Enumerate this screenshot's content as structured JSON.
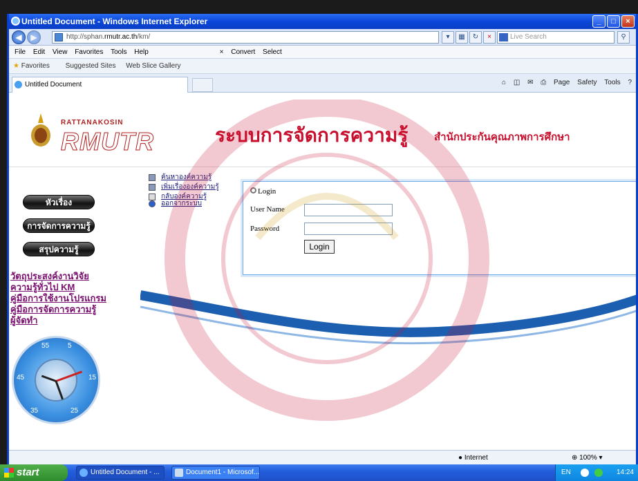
{
  "window": {
    "title": "Untitled Document - Windows Internet Explorer"
  },
  "address": {
    "url_prefix": "http://sphan.",
    "url_host": "rmutr.ac.th",
    "url_path": "/km/",
    "search_placeholder": "Live Search"
  },
  "menubar": {
    "items": [
      "File",
      "Edit",
      "View",
      "Favorites",
      "Tools",
      "Help"
    ],
    "convert": "Convert",
    "select": "Select"
  },
  "favbar": {
    "favorites": "Favorites",
    "suggested": "Suggested Sites",
    "webslice": "Web Slice Gallery"
  },
  "tab": {
    "title": "Untitled Document"
  },
  "cmdbar": {
    "page": "Page",
    "safety": "Safety",
    "tools": "Tools"
  },
  "banner": {
    "brand_top": "RATTANAKOSIN",
    "brand_main": "RMUTR",
    "title": "ระบบการจัดการความรู้",
    "subtitle": "สำนักประกันคุณภาพการศึกษา"
  },
  "left": {
    "pills": [
      "หัวเรื่อง",
      "การจัดการความรู้",
      "สรุปความรู้"
    ],
    "links": [
      "วัตถุประสงค์งานวิจัย",
      "ความรู้ทั่วไป KM",
      "คู่มือการใช้งานโปรแกรม",
      "คู่มือการจัดการความรู้",
      "ผู้จัดทำ"
    ]
  },
  "main_menu": [
    "ค้นหาองค์ความรู้",
    "เพิ่มเรื่ององค์ความรู้",
    "กลับองค์ความรู้",
    "ออกจากระบบ"
  ],
  "login": {
    "title": "Login",
    "username_label": "User Name",
    "password_label": "Password",
    "button": "Login"
  },
  "clock": {
    "numbers": [
      "55",
      "5",
      "45",
      "15",
      "35",
      "25"
    ]
  },
  "status": {
    "zone": "Internet",
    "zoom": "100%"
  },
  "taskbar": {
    "start": "start",
    "tasks": [
      "Untitled Document - ...",
      "Document1 - Microsof..."
    ],
    "lang": "EN",
    "time": "14:24"
  }
}
